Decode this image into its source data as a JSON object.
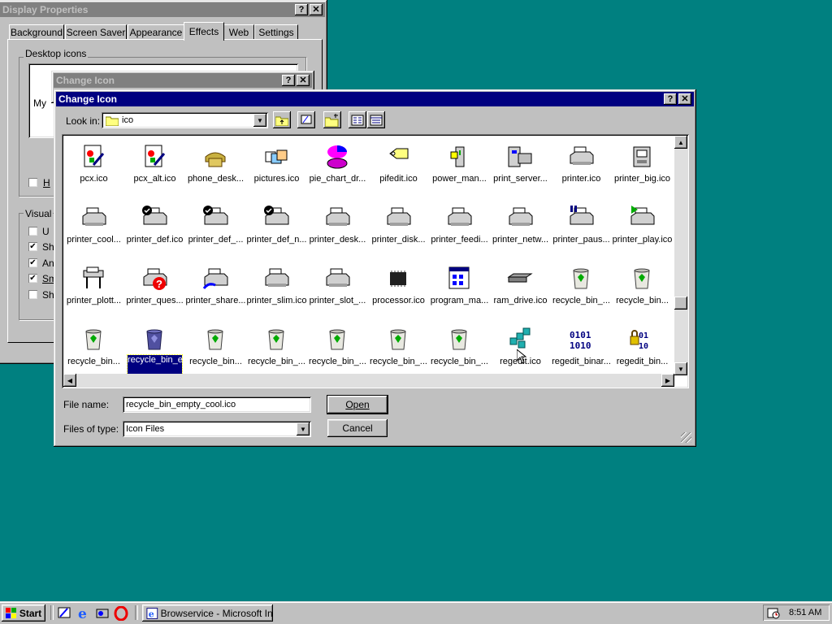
{
  "display_props": {
    "title": "Display Properties",
    "tabs": [
      "Background",
      "Screen Saver",
      "Appearance",
      "Effects",
      "Web",
      "Settings"
    ],
    "selected_tab": "Effects",
    "desktop_icons_label": "Desktop icons",
    "icon_label_partial": "My",
    "hide_label": "H",
    "visual_label": "Visual",
    "visual_checks": [
      {
        "label": "U",
        "checked": false
      },
      {
        "label": "Sh",
        "checked": true
      },
      {
        "label": "An",
        "checked": true
      },
      {
        "label": "Sm",
        "checked": true
      },
      {
        "label": "Sh",
        "checked": false
      }
    ]
  },
  "change_icon_back": {
    "title": "Change Icon"
  },
  "change_icon": {
    "title": "Change Icon",
    "look_in_label": "Look in:",
    "look_in_value": "ico",
    "file_name_label": "File name:",
    "file_name_value": "recycle_bin_empty_cool.ico",
    "files_of_type_label": "Files of type:",
    "files_of_type_value": "Icon Files",
    "open_label": "Open",
    "cancel_label": "Cancel",
    "help_glyph": "?",
    "close_glyph": "✕",
    "rows": [
      [
        {
          "label": "pcx.ico",
          "icon": "paint-doc-icon"
        },
        {
          "label": "pcx_alt.ico",
          "icon": "paint-doc-icon"
        },
        {
          "label": "phone_desk...",
          "icon": "phone-icon"
        },
        {
          "label": "pictures.ico",
          "icon": "pictures-icon"
        },
        {
          "label": "pie_chart_dr...",
          "icon": "pie-chart-icon"
        },
        {
          "label": "pifedit.ico",
          "icon": "pif-tag-icon"
        },
        {
          "label": "power_man...",
          "icon": "power-icon"
        },
        {
          "label": "print_server...",
          "icon": "print-server-icon"
        },
        {
          "label": "printer.ico",
          "icon": "printer-icon"
        },
        {
          "label": "printer_big.ico",
          "icon": "printer-big-icon"
        }
      ],
      [
        {
          "label": "printer_cool...",
          "icon": "printer-icon"
        },
        {
          "label": "printer_def.ico",
          "icon": "printer-default-icon"
        },
        {
          "label": "printer_def_...",
          "icon": "printer-default-icon"
        },
        {
          "label": "printer_def_n...",
          "icon": "printer-default-icon"
        },
        {
          "label": "printer_desk...",
          "icon": "printer-icon"
        },
        {
          "label": "printer_disk...",
          "icon": "printer-icon"
        },
        {
          "label": "printer_feedi...",
          "icon": "printer-icon"
        },
        {
          "label": "printer_netw...",
          "icon": "printer-icon"
        },
        {
          "label": "printer_paus...",
          "icon": "printer-pause-icon"
        },
        {
          "label": "printer_play.ico",
          "icon": "printer-play-icon"
        }
      ],
      [
        {
          "label": "printer_plott...",
          "icon": "plotter-icon"
        },
        {
          "label": "printer_ques...",
          "icon": "printer-question-icon"
        },
        {
          "label": "printer_share...",
          "icon": "printer-share-icon"
        },
        {
          "label": "printer_slim.ico",
          "icon": "printer-icon"
        },
        {
          "label": "printer_slot_...",
          "icon": "printer-icon"
        },
        {
          "label": "processor.ico",
          "icon": "processor-icon"
        },
        {
          "label": "program_ma...",
          "icon": "program-manager-icon"
        },
        {
          "label": "ram_drive.ico",
          "icon": "ram-drive-icon"
        },
        {
          "label": "recycle_bin_...",
          "icon": "recycle-bin-icon"
        },
        {
          "label": "recycle_bin...",
          "icon": "recycle-bin-icon"
        }
      ],
      [
        {
          "label": "recycle_bin...",
          "icon": "recycle-bin-icon"
        },
        {
          "label": "recycle_bin_empty_cool.ico",
          "icon": "recycle-bin-dark-icon",
          "selected": true
        },
        {
          "label": "recycle_bin...",
          "icon": "recycle-bin-icon"
        },
        {
          "label": "recycle_bin_...",
          "icon": "recycle-bin-icon"
        },
        {
          "label": "recycle_bin_...",
          "icon": "recycle-bin-icon"
        },
        {
          "label": "recycle_bin_...",
          "icon": "recycle-bin-icon"
        },
        {
          "label": "recycle_bin_...",
          "icon": "recycle-bin-icon"
        },
        {
          "label": "regedit.ico",
          "icon": "regedit-icon"
        },
        {
          "label": "regedit_binar...",
          "icon": "binary-icon"
        },
        {
          "label": "regedit_bin...",
          "icon": "binary-lock-icon"
        }
      ]
    ]
  },
  "taskbar": {
    "start_label": "Start",
    "task_label": "Browservice - Microsoft Int...",
    "clock": "8:51 AM"
  }
}
